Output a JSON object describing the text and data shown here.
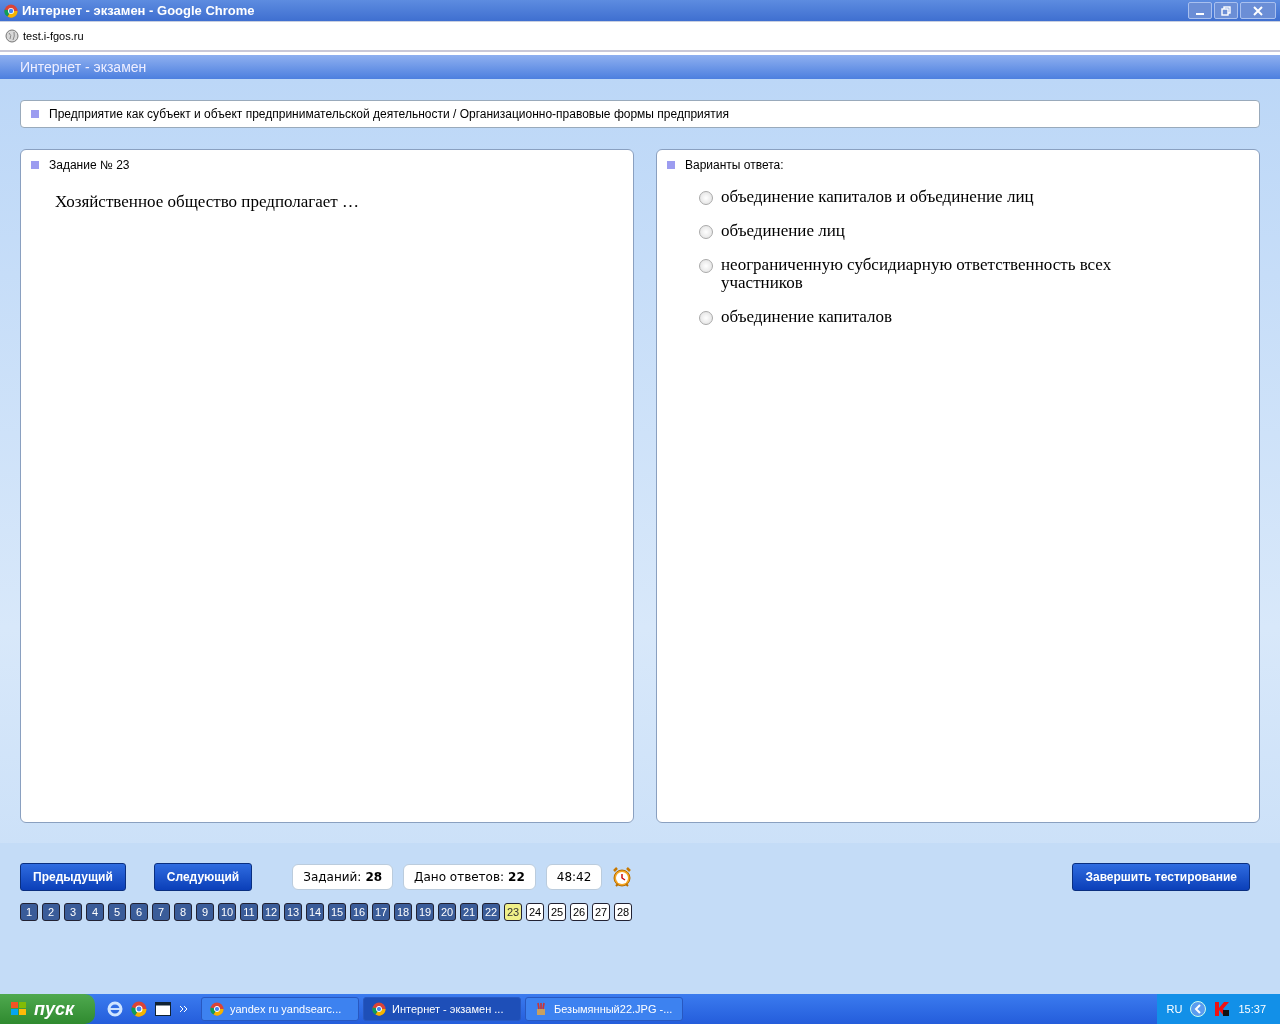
{
  "window": {
    "title": "Интернет - экзамен - Google Chrome"
  },
  "address_bar": {
    "url": "test.i-fgos.ru"
  },
  "app_header": {
    "title": "Интернет - экзамен"
  },
  "topic": {
    "text": "Предприятие как субъект и объект предпринимательской деятельности / Организационно-правовые формы предприятия"
  },
  "question": {
    "heading": "Задание № 23",
    "text": "Хозяйственное общество предполагает …"
  },
  "answers": {
    "heading": "Варианты ответа:",
    "options": [
      {
        "label": "объединение капиталов и объединение лиц",
        "selected": false
      },
      {
        "label": "объединение лиц",
        "selected": false
      },
      {
        "label": "неограниченную субсидиарную ответственность всех участников",
        "selected": false
      },
      {
        "label": "объединение капиталов",
        "selected": false
      }
    ]
  },
  "controls": {
    "prev": "Предыдущий",
    "next": "Следующий",
    "tasks_label": "Заданий:",
    "tasks_value": "28",
    "answered_label": "Дано ответов:",
    "answered_value": "22",
    "timer": "48:42",
    "finish": "Завершить тестирование"
  },
  "question_nav": [
    {
      "label": "1",
      "answered": true,
      "selected": false
    },
    {
      "label": "2",
      "answered": true,
      "selected": false
    },
    {
      "label": "3",
      "answered": true,
      "selected": false
    },
    {
      "label": "4",
      "answered": true,
      "selected": false
    },
    {
      "label": "5",
      "answered": true,
      "selected": false
    },
    {
      "label": "6",
      "answered": true,
      "selected": false
    },
    {
      "label": "7",
      "answered": true,
      "selected": false
    },
    {
      "label": "8",
      "answered": true,
      "selected": false
    },
    {
      "label": "9",
      "answered": true,
      "selected": false
    },
    {
      "label": "10",
      "answered": true,
      "selected": false
    },
    {
      "label": "11",
      "answered": true,
      "selected": false
    },
    {
      "label": "12",
      "answered": true,
      "selected": false
    },
    {
      "label": "13",
      "answered": true,
      "selected": false
    },
    {
      "label": "14",
      "answered": true,
      "selected": false
    },
    {
      "label": "15",
      "answered": true,
      "selected": false
    },
    {
      "label": "16",
      "answered": true,
      "selected": false
    },
    {
      "label": "17",
      "answered": true,
      "selected": false
    },
    {
      "label": "18",
      "answered": true,
      "selected": false
    },
    {
      "label": "19",
      "answered": true,
      "selected": false
    },
    {
      "label": "20",
      "answered": true,
      "selected": false
    },
    {
      "label": "21",
      "answered": true,
      "selected": false
    },
    {
      "label": "22",
      "answered": true,
      "selected": false
    },
    {
      "label": "23",
      "answered": false,
      "selected": true
    },
    {
      "label": "24",
      "answered": false,
      "selected": false
    },
    {
      "label": "25",
      "answered": false,
      "selected": false
    },
    {
      "label": "26",
      "answered": false,
      "selected": false
    },
    {
      "label": "27",
      "answered": false,
      "selected": false
    },
    {
      "label": "28",
      "answered": false,
      "selected": false
    }
  ],
  "taskbar": {
    "start": "пуск",
    "windows": [
      {
        "label": "yandex ru yandsearc...",
        "kind": "browser",
        "selected": false
      },
      {
        "label": "Интернет - экзамен ...",
        "kind": "browser",
        "selected": true
      },
      {
        "label": "Безымянный22.JPG -...",
        "kind": "paint",
        "selected": false
      }
    ],
    "language": "RU",
    "clock": "15:37"
  }
}
